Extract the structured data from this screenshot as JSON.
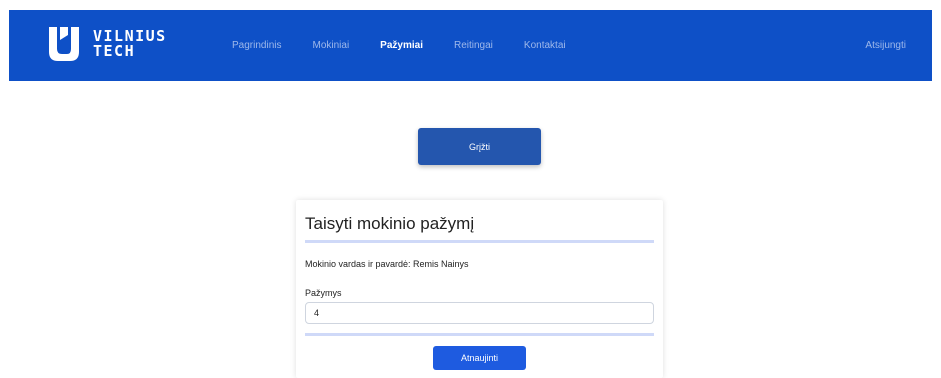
{
  "brand": {
    "line1": "VILNIUS",
    "line2": "TECH"
  },
  "nav": {
    "items": [
      {
        "label": "Pagrindinis",
        "active": false
      },
      {
        "label": "Mokiniai",
        "active": false
      },
      {
        "label": "Pažymiai",
        "active": true
      },
      {
        "label": "Reitingai",
        "active": false
      },
      {
        "label": "Kontaktai",
        "active": false
      }
    ],
    "logout_label": "Atsijungti"
  },
  "back_button": {
    "label": "Grįžti"
  },
  "form": {
    "title": "Taisyti mokinio pažymį",
    "student_info": "Mokinio vardas ir pavardė: Remis Nainys",
    "grade_label": "Pažymys",
    "grade_value": "4",
    "submit_label": "Atnaujinti"
  },
  "colors": {
    "navbar_bg": "#0e50c7",
    "back_button_bg": "#2456ae",
    "submit_button_bg": "#1e5be0",
    "divider": "#cfd9f8"
  },
  "icons": {
    "logo": "vilnius-tech-logo-icon"
  }
}
